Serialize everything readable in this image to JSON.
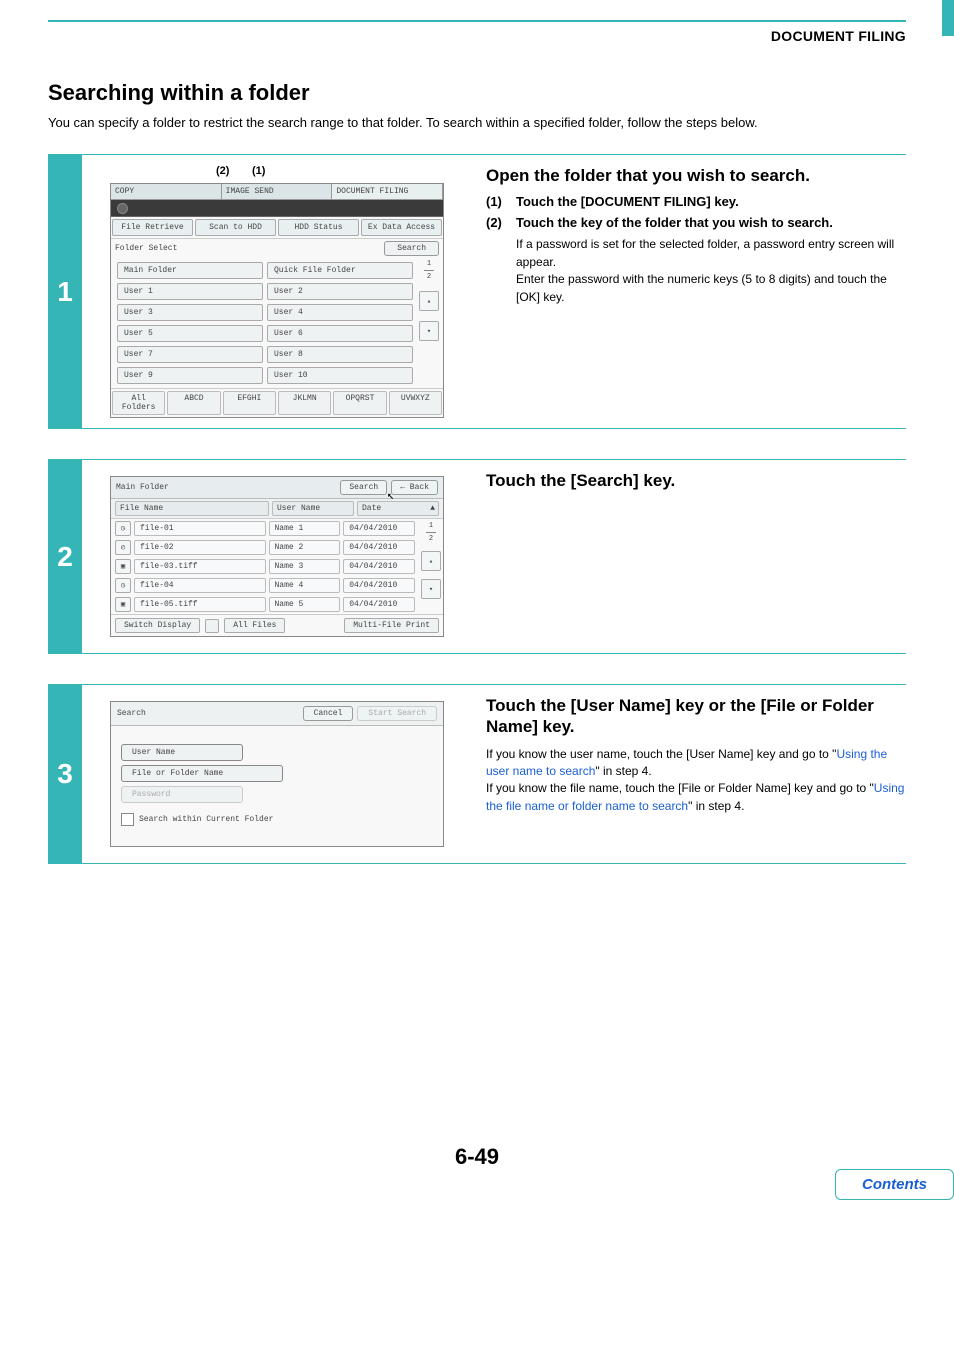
{
  "header": {
    "doc_title": "DOCUMENT FILING"
  },
  "section": {
    "title": "Searching within a folder",
    "intro": "You can specify a folder to restrict the search range to that folder. To search within a specified folder, follow the steps below."
  },
  "callouts": {
    "c1": "(1)",
    "c2": "(2)"
  },
  "step1": {
    "num": "1",
    "title": "Open the folder that you wish to search.",
    "items": [
      {
        "num": "(1)",
        "txt": "Touch the [DOCUMENT FILING] key."
      },
      {
        "num": "(2)",
        "txt": "Touch the key of the folder that you wish to search."
      }
    ],
    "note1": "If a password is set for the selected folder, a password entry screen will appear.",
    "note2": "Enter the password with the numeric keys (5 to 8 digits) and touch the [OK] key.",
    "shot": {
      "tabs": {
        "copy": "COPY",
        "imagesend": "IMAGE SEND",
        "docfiling": "DOCUMENT FILING"
      },
      "subtabs": {
        "fr": "File Retrieve",
        "sh": "Scan to HDD",
        "hs": "HDD Status",
        "ed": "Ex Data Access"
      },
      "fsel": "Folder Select",
      "search": "Search",
      "main": "Main Folder",
      "quick": "Quick File Folder",
      "users": [
        "User 1",
        "User 2",
        "User 3",
        "User 4",
        "User 5",
        "User 6",
        "User 7",
        "User 8",
        "User 9",
        "User 10"
      ],
      "pag_top": "1",
      "pag_bot": "2",
      "alpha": [
        "All Folders",
        "ABCD",
        "EFGHI",
        "JKLMN",
        "OPQRST",
        "UVWXYZ"
      ]
    }
  },
  "step2": {
    "num": "2",
    "title": "Touch the [Search] key.",
    "shot": {
      "folder": "Main Folder",
      "search": "Search",
      "back": "Back",
      "cols": {
        "fn": "File Name",
        "un": "User Name",
        "dt": "Date"
      },
      "rows": [
        {
          "fn": "file-01",
          "un": "Name 1",
          "dt": "04/04/2010"
        },
        {
          "fn": "file-02",
          "un": "Name 2",
          "dt": "04/04/2010"
        },
        {
          "fn": "file-03.tiff",
          "un": "Name 3",
          "dt": "04/04/2010"
        },
        {
          "fn": "file-04",
          "un": "Name 4",
          "dt": "04/04/2010"
        },
        {
          "fn": "file-05.tiff",
          "un": "Name 5",
          "dt": "04/04/2010"
        }
      ],
      "pag_top": "1",
      "pag_bot": "2",
      "ftr": {
        "switch": "Switch Display",
        "all": "All Files",
        "multi": "Multi-File Print"
      }
    }
  },
  "step3": {
    "num": "3",
    "title": "Touch the [User Name] key or the [File or Folder Name] key.",
    "para_a": "If you know the user name, touch the [User Name] key and go to \"",
    "link_a": "Using the user name to search",
    "para_b": "\" in step 4.",
    "para_c": "If you know the file name, touch the [File or Folder Name] key and go to \"",
    "link_b": "Using the file name or folder name to search",
    "para_d": "\" in step 4.",
    "shot": {
      "title": "Search",
      "cancel": "Cancel",
      "start": "Start Search",
      "un": "User Name",
      "ffn": "File or Folder Name",
      "pw": "Password",
      "chk": "Search within Current Folder"
    }
  },
  "footer": {
    "page_num": "6-49",
    "contents": "Contents"
  }
}
